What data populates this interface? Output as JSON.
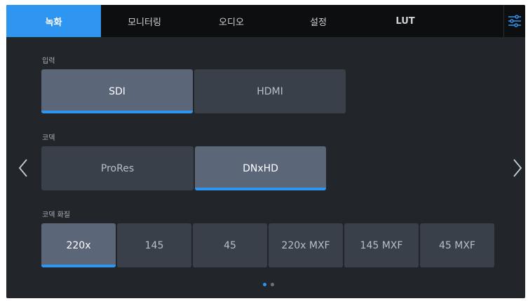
{
  "tabs": [
    {
      "label": "녹화",
      "active": true
    },
    {
      "label": "모니터링",
      "active": false
    },
    {
      "label": "오디오",
      "active": false
    },
    {
      "label": "설정",
      "active": false
    },
    {
      "label": "LUT",
      "active": false
    }
  ],
  "settings_icon": "sliders-icon",
  "sections": {
    "input": {
      "label": "입력",
      "options": [
        "SDI",
        "HDMI"
      ],
      "selected": "SDI"
    },
    "codec": {
      "label": "코덱",
      "options": [
        "ProRes",
        "DNxHD"
      ],
      "selected": "DNxHD"
    },
    "quality": {
      "label": "코덱 화질",
      "options": [
        "220x",
        "145",
        "45",
        "220x MXF",
        "145 MXF",
        "45 MXF"
      ],
      "selected": "220x"
    }
  },
  "navigation": {
    "prev_icon": "chevron-left-icon",
    "next_icon": "chevron-right-icon"
  },
  "pagination": {
    "pages": 2,
    "current": 1
  },
  "colors": {
    "accent": "#2e95f1",
    "background": "#22252a",
    "tabbar": "#0d0e10",
    "button": "#3a4049",
    "button_selected": "#5b6679"
  }
}
